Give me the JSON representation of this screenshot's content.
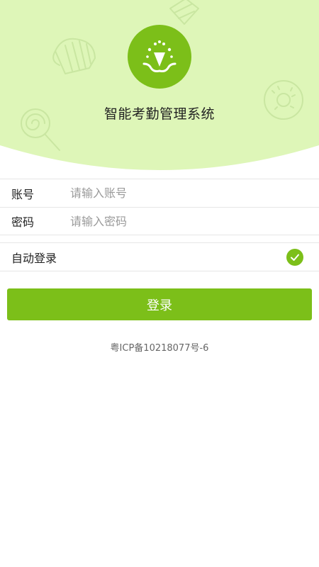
{
  "app": {
    "title": "智能考勤管理系统"
  },
  "login_form": {
    "account": {
      "label": "账号",
      "placeholder": "请输入账号",
      "value": ""
    },
    "password": {
      "label": "密码",
      "placeholder": "请输入密码",
      "value": ""
    },
    "auto_login": {
      "label": "自动登录",
      "checked": true
    },
    "submit_label": "登录"
  },
  "footer": {
    "icp": "粤ICP备10218077号-6"
  },
  "icons": {
    "logo": "app-logo-icon",
    "check": "check-icon",
    "decor": [
      "cupcake-icon",
      "lollipop-icon",
      "donut-icon",
      "candy-icon"
    ]
  },
  "colors": {
    "accent": "#7cbf19",
    "hero_background": "#def6b8",
    "decor_stroke": "#c9e6a1"
  }
}
